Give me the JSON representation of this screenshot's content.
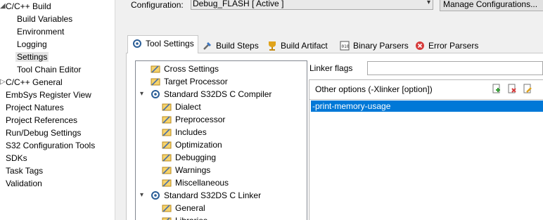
{
  "left_nav": {
    "items": [
      {
        "label": "C/C++ Build",
        "expanded": true
      },
      {
        "label": "Build Variables"
      },
      {
        "label": "Environment"
      },
      {
        "label": "Logging"
      },
      {
        "label": "Settings",
        "selected": true
      },
      {
        "label": "Tool Chain Editor"
      },
      {
        "label": "C/C++ General",
        "collapsed": true
      },
      {
        "label": "EmbSys Register View"
      },
      {
        "label": "Project Natures"
      },
      {
        "label": "Project References"
      },
      {
        "label": "Run/Debug Settings"
      },
      {
        "label": "S32 Configuration Tools"
      },
      {
        "label": "SDKs"
      },
      {
        "label": "Task Tags"
      },
      {
        "label": "Validation"
      }
    ]
  },
  "config": {
    "label": "Configuration:",
    "value": "Debug_FLASH  [ Active ]",
    "manage_label": "Manage Configurations..."
  },
  "tabs": [
    {
      "label": "Tool Settings",
      "icon": "tool-settings-icon",
      "active": true
    },
    {
      "label": "Build Steps",
      "icon": "build-steps-icon"
    },
    {
      "label": "Build Artifact",
      "icon": "build-artifact-icon"
    },
    {
      "label": "Binary Parsers",
      "icon": "binary-parsers-icon"
    },
    {
      "label": "Error Parsers",
      "icon": "error-parsers-icon"
    }
  ],
  "tool_tree": [
    {
      "label": "Cross Settings",
      "icon": "settings-icon"
    },
    {
      "label": "Target Processor",
      "icon": "settings-icon"
    },
    {
      "label": "Standard S32DS C Compiler",
      "icon": "tool-icon",
      "expanded": true
    },
    {
      "label": "Dialect",
      "icon": "settings-icon"
    },
    {
      "label": "Preprocessor",
      "icon": "settings-icon"
    },
    {
      "label": "Includes",
      "icon": "settings-icon"
    },
    {
      "label": "Optimization",
      "icon": "settings-icon"
    },
    {
      "label": "Debugging",
      "icon": "settings-icon"
    },
    {
      "label": "Warnings",
      "icon": "settings-icon"
    },
    {
      "label": "Miscellaneous",
      "icon": "settings-icon"
    },
    {
      "label": "Standard S32DS C Linker",
      "icon": "tool-icon",
      "expanded": true
    },
    {
      "label": "General",
      "icon": "settings-icon"
    },
    {
      "label": "Libraries",
      "icon": "settings-icon"
    }
  ],
  "linker": {
    "flags_label": "Linker flags",
    "flags_value": "",
    "options_header": "Other options (-Xlinker [option])",
    "options": [
      "-print-memory-usage"
    ]
  },
  "colors": {
    "selection": "#0078d7",
    "panel_bg": "#f0f0f0"
  }
}
